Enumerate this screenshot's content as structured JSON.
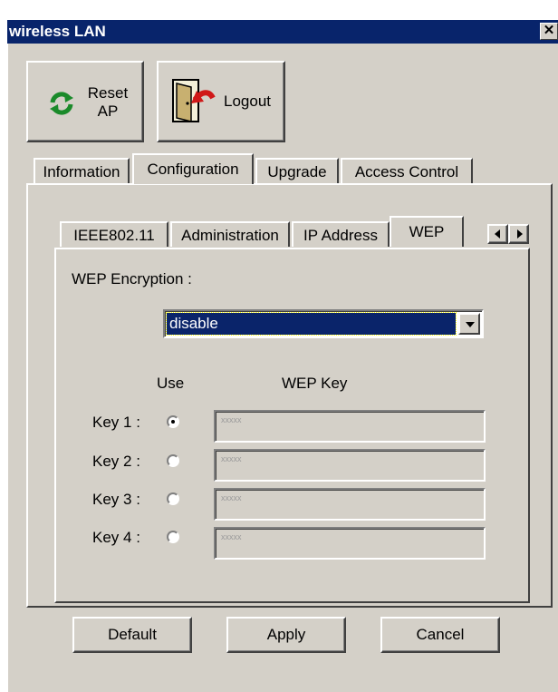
{
  "window": {
    "title": "wireless LAN",
    "close_symbol": "✕"
  },
  "toolbar": {
    "reset_line1": "Reset",
    "reset_line2": "AP",
    "logout_label": "Logout"
  },
  "main_tabs": [
    "Information",
    "Configuration",
    "Upgrade",
    "Access Control"
  ],
  "sub_tabs": [
    "IEEE802.11",
    "Administration",
    "IP Address",
    "WEP"
  ],
  "wep": {
    "encryption_label": "WEP Encryption :",
    "encryption_value": "disable",
    "use_header": "Use",
    "key_header": "WEP Key",
    "keys": [
      {
        "label": "Key 1 :",
        "value": "xxxxx",
        "selected": true
      },
      {
        "label": "Key 2 :",
        "value": "xxxxx",
        "selected": false
      },
      {
        "label": "Key 3 :",
        "value": "xxxxx",
        "selected": false
      },
      {
        "label": "Key 4 :",
        "value": "xxxxx",
        "selected": false
      }
    ]
  },
  "buttons": {
    "default": "Default",
    "apply": "Apply",
    "cancel": "Cancel"
  },
  "colors": {
    "titlebar": "#08246b",
    "face": "#d4d0c8",
    "selection": "#0a246a"
  }
}
